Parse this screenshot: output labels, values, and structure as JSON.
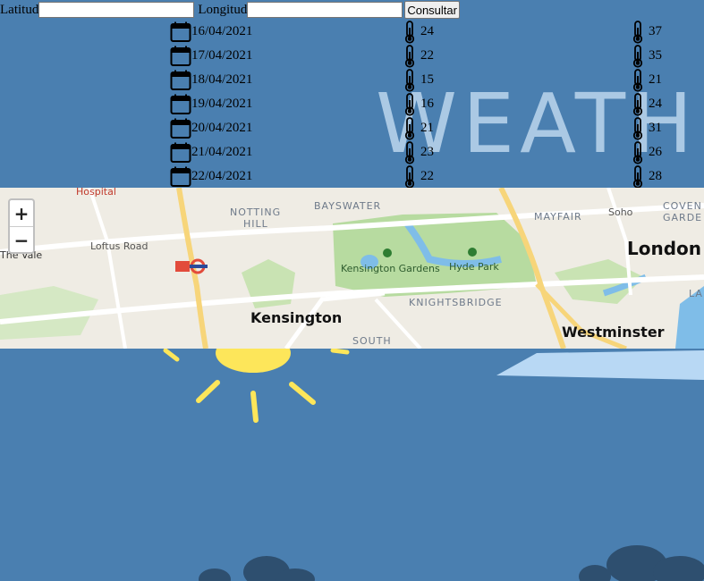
{
  "form": {
    "lat_label": "Latitud",
    "lat_value": "",
    "lon_label": "Longitud",
    "lon_value": "",
    "submit_label": "Consultar"
  },
  "forecast": [
    {
      "date": "16/04/2021",
      "min": "24",
      "max": "37"
    },
    {
      "date": "17/04/2021",
      "min": "22",
      "max": "35"
    },
    {
      "date": "18/04/2021",
      "min": "15",
      "max": "21"
    },
    {
      "date": "19/04/2021",
      "min": "16",
      "max": "24"
    },
    {
      "date": "20/04/2021",
      "min": "21",
      "max": "31"
    },
    {
      "date": "21/04/2021",
      "min": "23",
      "max": "26"
    },
    {
      "date": "22/04/2021",
      "min": "22",
      "max": "28"
    }
  ],
  "background": {
    "text": "WEATH"
  },
  "map": {
    "zoom_in": "+",
    "zoom_out": "−",
    "labels": {
      "hospital": "Hospital",
      "notting_hill_1": "NOTTING",
      "notting_hill_2": "HILL",
      "bayswater": "BAYSWATER",
      "mayfair": "MAYFAIR",
      "soho": "Soho",
      "covent_1": "COVEN",
      "covent_2": "GARDE",
      "loftus": "Loftus Road",
      "the_vale": "The Vale",
      "kensington_gardens": "Kensington Gardens",
      "hyde_park": "Hyde Park",
      "london": "London",
      "kensington": "Kensington",
      "knightsbridge": "KNIGHTSBRIDGE",
      "westminster": "Westminster",
      "south": "SOUTH",
      "la": "LA"
    }
  },
  "icons": {
    "date": "calendar-icon",
    "temp": "thermometer-icon"
  }
}
